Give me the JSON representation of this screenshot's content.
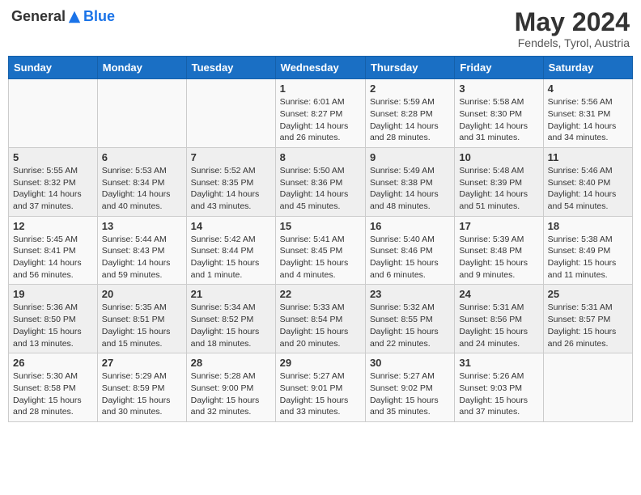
{
  "header": {
    "logo_general": "General",
    "logo_blue": "Blue",
    "month": "May 2024",
    "location": "Fendels, Tyrol, Austria"
  },
  "weekdays": [
    "Sunday",
    "Monday",
    "Tuesday",
    "Wednesday",
    "Thursday",
    "Friday",
    "Saturday"
  ],
  "weeks": [
    [
      {
        "day": "",
        "info": ""
      },
      {
        "day": "",
        "info": ""
      },
      {
        "day": "",
        "info": ""
      },
      {
        "day": "1",
        "info": "Sunrise: 6:01 AM\nSunset: 8:27 PM\nDaylight: 14 hours and 26 minutes."
      },
      {
        "day": "2",
        "info": "Sunrise: 5:59 AM\nSunset: 8:28 PM\nDaylight: 14 hours and 28 minutes."
      },
      {
        "day": "3",
        "info": "Sunrise: 5:58 AM\nSunset: 8:30 PM\nDaylight: 14 hours and 31 minutes."
      },
      {
        "day": "4",
        "info": "Sunrise: 5:56 AM\nSunset: 8:31 PM\nDaylight: 14 hours and 34 minutes."
      }
    ],
    [
      {
        "day": "5",
        "info": "Sunrise: 5:55 AM\nSunset: 8:32 PM\nDaylight: 14 hours and 37 minutes."
      },
      {
        "day": "6",
        "info": "Sunrise: 5:53 AM\nSunset: 8:34 PM\nDaylight: 14 hours and 40 minutes."
      },
      {
        "day": "7",
        "info": "Sunrise: 5:52 AM\nSunset: 8:35 PM\nDaylight: 14 hours and 43 minutes."
      },
      {
        "day": "8",
        "info": "Sunrise: 5:50 AM\nSunset: 8:36 PM\nDaylight: 14 hours and 45 minutes."
      },
      {
        "day": "9",
        "info": "Sunrise: 5:49 AM\nSunset: 8:38 PM\nDaylight: 14 hours and 48 minutes."
      },
      {
        "day": "10",
        "info": "Sunrise: 5:48 AM\nSunset: 8:39 PM\nDaylight: 14 hours and 51 minutes."
      },
      {
        "day": "11",
        "info": "Sunrise: 5:46 AM\nSunset: 8:40 PM\nDaylight: 14 hours and 54 minutes."
      }
    ],
    [
      {
        "day": "12",
        "info": "Sunrise: 5:45 AM\nSunset: 8:41 PM\nDaylight: 14 hours and 56 minutes."
      },
      {
        "day": "13",
        "info": "Sunrise: 5:44 AM\nSunset: 8:43 PM\nDaylight: 14 hours and 59 minutes."
      },
      {
        "day": "14",
        "info": "Sunrise: 5:42 AM\nSunset: 8:44 PM\nDaylight: 15 hours and 1 minute."
      },
      {
        "day": "15",
        "info": "Sunrise: 5:41 AM\nSunset: 8:45 PM\nDaylight: 15 hours and 4 minutes."
      },
      {
        "day": "16",
        "info": "Sunrise: 5:40 AM\nSunset: 8:46 PM\nDaylight: 15 hours and 6 minutes."
      },
      {
        "day": "17",
        "info": "Sunrise: 5:39 AM\nSunset: 8:48 PM\nDaylight: 15 hours and 9 minutes."
      },
      {
        "day": "18",
        "info": "Sunrise: 5:38 AM\nSunset: 8:49 PM\nDaylight: 15 hours and 11 minutes."
      }
    ],
    [
      {
        "day": "19",
        "info": "Sunrise: 5:36 AM\nSunset: 8:50 PM\nDaylight: 15 hours and 13 minutes."
      },
      {
        "day": "20",
        "info": "Sunrise: 5:35 AM\nSunset: 8:51 PM\nDaylight: 15 hours and 15 minutes."
      },
      {
        "day": "21",
        "info": "Sunrise: 5:34 AM\nSunset: 8:52 PM\nDaylight: 15 hours and 18 minutes."
      },
      {
        "day": "22",
        "info": "Sunrise: 5:33 AM\nSunset: 8:54 PM\nDaylight: 15 hours and 20 minutes."
      },
      {
        "day": "23",
        "info": "Sunrise: 5:32 AM\nSunset: 8:55 PM\nDaylight: 15 hours and 22 minutes."
      },
      {
        "day": "24",
        "info": "Sunrise: 5:31 AM\nSunset: 8:56 PM\nDaylight: 15 hours and 24 minutes."
      },
      {
        "day": "25",
        "info": "Sunrise: 5:31 AM\nSunset: 8:57 PM\nDaylight: 15 hours and 26 minutes."
      }
    ],
    [
      {
        "day": "26",
        "info": "Sunrise: 5:30 AM\nSunset: 8:58 PM\nDaylight: 15 hours and 28 minutes."
      },
      {
        "day": "27",
        "info": "Sunrise: 5:29 AM\nSunset: 8:59 PM\nDaylight: 15 hours and 30 minutes."
      },
      {
        "day": "28",
        "info": "Sunrise: 5:28 AM\nSunset: 9:00 PM\nDaylight: 15 hours and 32 minutes."
      },
      {
        "day": "29",
        "info": "Sunrise: 5:27 AM\nSunset: 9:01 PM\nDaylight: 15 hours and 33 minutes."
      },
      {
        "day": "30",
        "info": "Sunrise: 5:27 AM\nSunset: 9:02 PM\nDaylight: 15 hours and 35 minutes."
      },
      {
        "day": "31",
        "info": "Sunrise: 5:26 AM\nSunset: 9:03 PM\nDaylight: 15 hours and 37 minutes."
      },
      {
        "day": "",
        "info": ""
      }
    ]
  ]
}
